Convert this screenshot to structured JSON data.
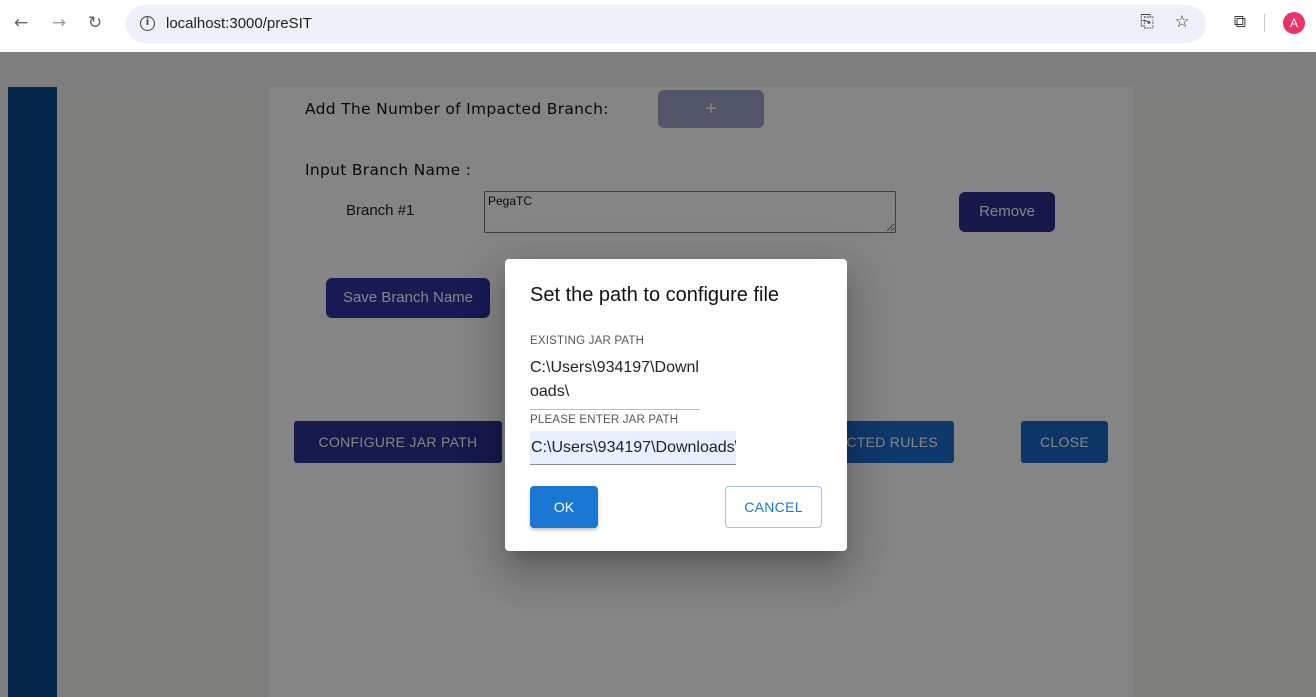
{
  "browser": {
    "url": "localhost:3000/preSIT",
    "avatar_letter": "A",
    "icons": [
      "back-arrow-icon",
      "forward-arrow-icon",
      "reload-icon",
      "site-info-icon",
      "install-app-icon",
      "bookmark-star-icon",
      "extensions-icon"
    ]
  },
  "page": {
    "impacted_label": "Add The Number of Impacted Branch:",
    "add_button_label": "+",
    "input_branch_label": "Input Branch Name :",
    "branch": {
      "label": "Branch #1",
      "value": "PegaTC"
    },
    "remove_label": "Remove",
    "save_label": "Save Branch Name",
    "configure_label": "CONFIGURE JAR PATH",
    "impacted_rules_label": "CTED RULES",
    "close_label": "CLOSE"
  },
  "dialog": {
    "title": "Set the path to configure file",
    "existing_label": "EXISTING JAR PATH",
    "existing_value": "C:\\Users\\934197\\Downloads\\",
    "enter_label": "PLEASE ENTER JAR PATH",
    "input_value": "C:\\Users\\934197\\Downloads\\",
    "ok_label": "OK",
    "cancel_label": "CANCEL"
  },
  "colors": {
    "sidebar": "#0b4e8c",
    "primary": "#1976d2",
    "indigo": "#2d3192"
  }
}
